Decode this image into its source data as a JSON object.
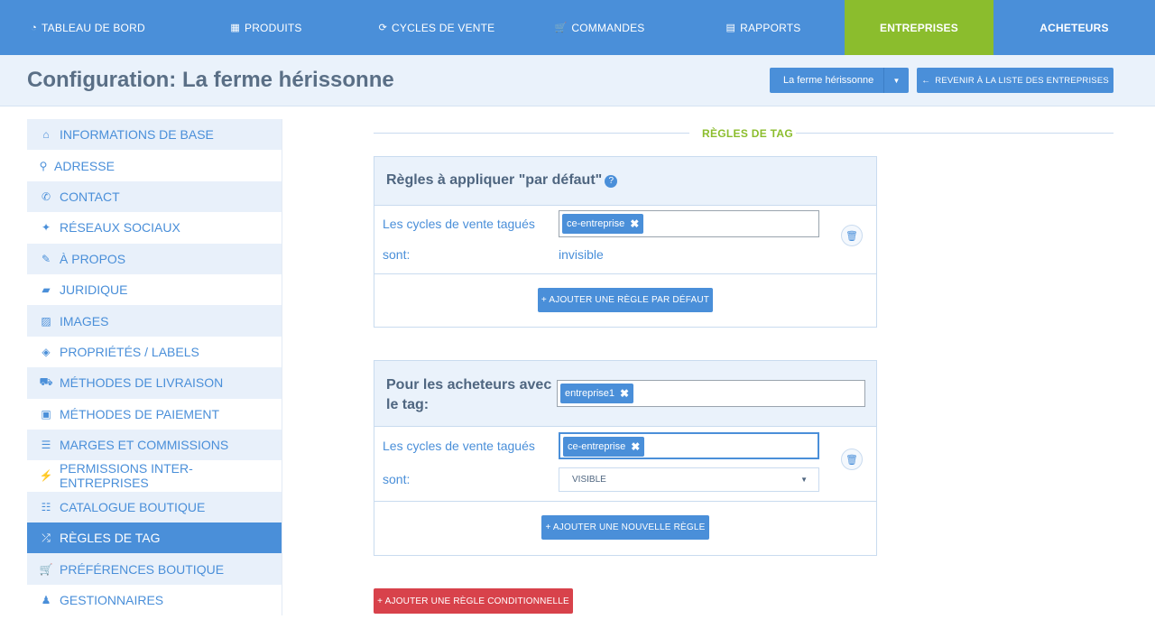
{
  "nav": {
    "items": [
      {
        "label": "TABLEAU DE BORD",
        "icon": "dashboard-icon"
      },
      {
        "label": "PRODUITS",
        "icon": "grid-icon"
      },
      {
        "label": "CYCLES DE VENTE",
        "icon": "refresh-icon"
      },
      {
        "label": "COMMANDES",
        "icon": "cart-icon"
      },
      {
        "label": "RAPPORTS",
        "icon": "file-icon"
      },
      {
        "label": "ENTREPRISES",
        "active": true
      },
      {
        "label": "ACHETEURS"
      }
    ]
  },
  "header": {
    "title": "Configuration: La ferme hérissonne",
    "company_select": "La ferme hérissonne",
    "back_button": "REVENIR À LA LISTE DES ENTREPRISES"
  },
  "sidebar": {
    "items": [
      {
        "label": "INFORMATIONS DE BASE",
        "icon": "home-icon"
      },
      {
        "label": "ADRESSE",
        "icon": "map-marker-icon"
      },
      {
        "label": "CONTACT",
        "icon": "phone-icon"
      },
      {
        "label": "RÉSEAUX SOCIAUX",
        "icon": "twitter-icon"
      },
      {
        "label": "À PROPOS",
        "icon": "pencil-icon"
      },
      {
        "label": "JURIDIQUE",
        "icon": "briefcase-icon"
      },
      {
        "label": "IMAGES",
        "icon": "image-icon"
      },
      {
        "label": "PROPRIÉTÉS / LABELS",
        "icon": "tags-icon"
      },
      {
        "label": "MÉTHODES DE LIVRAISON",
        "icon": "truck-icon"
      },
      {
        "label": "MÉTHODES DE PAIEMENT",
        "icon": "money-icon"
      },
      {
        "label": "MARGES ET COMMISSIONS",
        "icon": "list-icon"
      },
      {
        "label": "PERMISSIONS INTER-ENTREPRISES",
        "icon": "plug-icon"
      },
      {
        "label": "CATALOGUE BOUTIQUE",
        "icon": "list-ul-icon"
      },
      {
        "label": "RÈGLES DE TAG",
        "icon": "random-icon",
        "active": true
      },
      {
        "label": "PRÉFÉRENCES BOUTIQUE",
        "icon": "cart-icon"
      },
      {
        "label": "GESTIONNAIRES",
        "icon": "user-icon"
      }
    ]
  },
  "section": {
    "title": "RÈGLES DE TAG"
  },
  "default_panel": {
    "title": "Règles à appliquer \"par défaut\"",
    "help": "?",
    "cycles_label": "Les cycles de vente tagués",
    "tag": "ce-entreprise",
    "tag_remove": "✖",
    "sont_label": "sont:",
    "value": "invisible",
    "add_button": "+ AJOUTER UNE RÈGLE PAR DÉFAUT"
  },
  "conditional_panel": {
    "title_line1": "Pour les acheteurs avec",
    "title_line2": "le tag:",
    "buyer_tag": "entreprise1",
    "cycles_label": "Les cycles de vente tagués",
    "tag": "ce-entreprise",
    "tag_remove": "✖",
    "sont_label": "sont:",
    "select_value": "VISIBLE",
    "add_button": "+ AJOUTER UNE NOUVELLE RÈGLE"
  },
  "add_conditional_button": "+ AJOUTER UNE RÈGLE CONDITIONNELLE",
  "colors": {
    "primary": "#4a8fd9",
    "active_nav": "#8bbd2d",
    "danger": "#d8424b"
  }
}
